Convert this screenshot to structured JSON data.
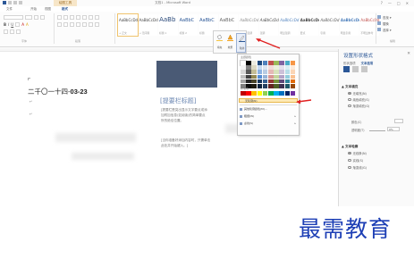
{
  "window": {
    "title": "文档1 - Microsoft Word",
    "contextual_tab": "绘图工具",
    "controls": [
      "?",
      "—",
      "□",
      "✕"
    ]
  },
  "tabs": [
    {
      "label": "文件"
    },
    {
      "label": "开始"
    },
    {
      "label": "视图"
    },
    {
      "label": "格式"
    }
  ],
  "ribbon": {
    "font_group_label": "字体",
    "paragraph_group_label": "段落",
    "styles_group_label": "样式",
    "editing_group_label": "编辑",
    "font_buttons": [
      "B",
      "I",
      "U",
      "A",
      "A"
    ],
    "styles": [
      {
        "sample": "AaBbCcDd",
        "caption": "→ 正文"
      },
      {
        "sample": "AaBbCcDd",
        "caption": "→ 无间隔"
      },
      {
        "sample": "AaBb",
        "caption": "标题 1"
      },
      {
        "sample": "AaBbC",
        "caption": "标题 2"
      },
      {
        "sample": "AaBbC",
        "caption": "标题"
      },
      {
        "sample": "AaBbC",
        "caption": "副标题"
      },
      {
        "sample": "AaBbCcDd",
        "caption": "不明显强调"
      },
      {
        "sample": "AaBbCcDd",
        "caption": "强调"
      },
      {
        "sample": "AaBbCcDd",
        "caption": "明显强调"
      },
      {
        "sample": "AaBbCcDd",
        "caption": "要点"
      },
      {
        "sample": "AaBbCcDd",
        "caption": "引用"
      },
      {
        "sample": "AaBbCcDd",
        "caption": "明显引用"
      },
      {
        "sample": "AaBbCcDd",
        "caption": "不明显参考"
      }
    ],
    "editing": [
      "查找 ▾",
      "替换",
      "选择 ▾"
    ]
  },
  "shape_buttons": [
    {
      "label": "填充"
    },
    {
      "label": "效果"
    },
    {
      "label": "轮廓"
    }
  ],
  "outline_dropdown": {
    "theme_colors_header": "主题颜色",
    "standard_colors_header": "标准色",
    "no_outline": "无轮廓(N)",
    "items": [
      {
        "label": "其他轮廓颜色(M)...",
        "has_submenu": false
      },
      {
        "label": "粗细(W)",
        "has_submenu": true
      },
      {
        "label": "虚线(S)",
        "has_submenu": true
      }
    ],
    "theme_colors": [
      "#ffffff",
      "#000000",
      "#eeece1",
      "#1f497d",
      "#4f81bd",
      "#c0504d",
      "#9bbb59",
      "#8064a2",
      "#4bacc6",
      "#f79646",
      "#f2f2f2",
      "#7f7f7f",
      "#ddd9c3",
      "#c6d9f0",
      "#dbe5f1",
      "#f2dcdb",
      "#ebf1dd",
      "#e5e0ec",
      "#dbeef3",
      "#fdeada",
      "#d8d8d8",
      "#595959",
      "#c4bd97",
      "#8db3e2",
      "#b8cce4",
      "#e5b9b7",
      "#d7e3bc",
      "#ccc1d9",
      "#b7dde8",
      "#fbd5b5",
      "#bfbfbf",
      "#3f3f3f",
      "#938953",
      "#548dd4",
      "#95b3d7",
      "#d99694",
      "#c3d69b",
      "#b2a2c7",
      "#92cddc",
      "#fac08f",
      "#a5a5a5",
      "#262626",
      "#494429",
      "#17365d",
      "#366092",
      "#953734",
      "#76923c",
      "#5f497a",
      "#31859b",
      "#e36c09",
      "#7f7f7f",
      "#0c0c0c",
      "#1d1b10",
      "#0f243e",
      "#244061",
      "#632423",
      "#4f6128",
      "#3f3151",
      "#205867",
      "#974806"
    ],
    "standard_colors": [
      "#c00000",
      "#ff0000",
      "#ffc000",
      "#ffff00",
      "#92d050",
      "#00b050",
      "#00b0f0",
      "#0070c0",
      "#002060",
      "#7030a0"
    ]
  },
  "document": {
    "date_prefix": "二千〇一十四-",
    "date_suffix": "03-23",
    "quote_title": "[提要栏标题]",
    "quote_lines": [
      "[提要栏是突出显示文字要点或添",
      "加附加信息(如阅读)的简单要点",
      "所的绝佳位置。"
    ],
    "quote_lines2": [
      "[当你准备好添加内容时，只需单击",
      "此处并开始键入。]"
    ]
  },
  "pane": {
    "title": "设置形状格式",
    "subtabs": [
      "形状选项",
      "文本选项"
    ],
    "section_fill": "▲ 文本填充",
    "fill_options": [
      {
        "label": "无填充(N)",
        "on": true
      },
      {
        "label": "纯色填充(S)",
        "on": false
      },
      {
        "label": "渐变填充(G)",
        "on": false
      }
    ],
    "color_label": "颜色(C)",
    "transparency_label": "透明度(T)",
    "transparency_value": "0%",
    "section_outline": "▲ 文本轮廓",
    "outline_options": [
      {
        "label": "无线条(N)",
        "on": true
      },
      {
        "label": "实线(S)",
        "on": false
      },
      {
        "label": "渐变线(G)",
        "on": false
      }
    ]
  },
  "watermark": "最需教育"
}
